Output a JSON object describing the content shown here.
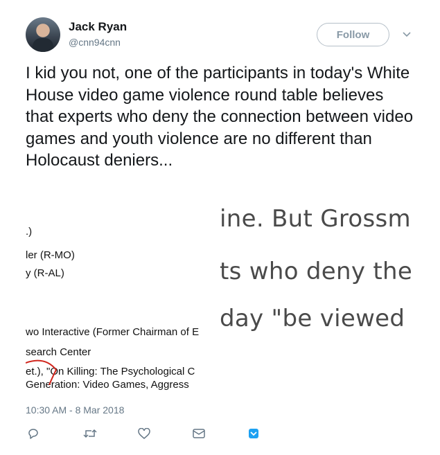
{
  "author": {
    "name": "Jack Ryan",
    "handle": "@cnn94cnn",
    "avatar_icon": "avatar-photo"
  },
  "follow_label": "Follow",
  "menu_icon": "chevron-down-icon",
  "tweet_text": "I kid you not, one of the participants in today's White House video game violence round table believes that experts who deny the connection between video games and youth violence are no different than Holocaust deniers...",
  "embedded_image": {
    "left_lines": [
      ".)",
      "ler (R-MO)",
      "y (R-AL)",
      "wo Interactive (Former Chairman of E",
      "search Center",
      "et.), \"On Killing: The Psychological C",
      "Generation: Video Games, Aggress"
    ],
    "right_lines": [
      "ine. But Grossm",
      "ts who deny the",
      "day \"be viewed"
    ]
  },
  "timestamp": "10:30 AM - 8 Mar 2018",
  "actions": [
    {
      "icon": "reply-icon"
    },
    {
      "icon": "retweet-icon"
    },
    {
      "icon": "like-icon"
    },
    {
      "icon": "direct-message-icon"
    },
    {
      "icon": "save-icon"
    }
  ],
  "colors": {
    "text": "#14171a",
    "secondary": "#657786",
    "border": "#b5bfc8",
    "annotation_red": "#d0241b",
    "save_blue": "#1da1f2"
  }
}
